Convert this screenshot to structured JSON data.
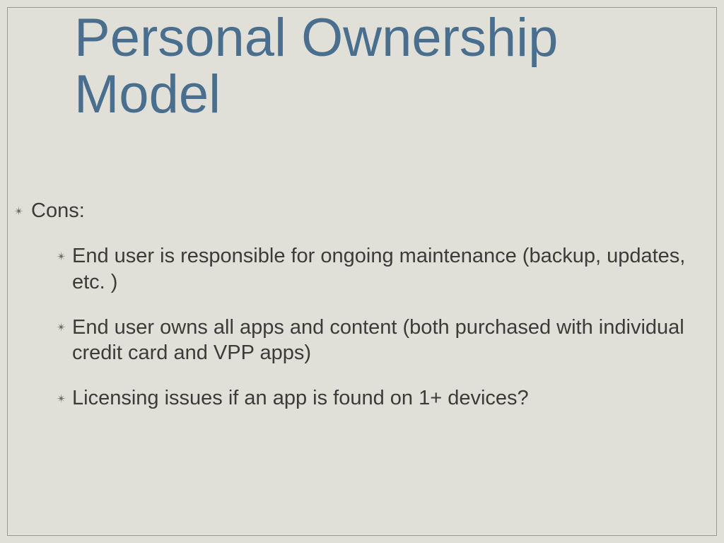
{
  "slide": {
    "title": "Personal Ownership Model",
    "section_label": "Cons:",
    "bullets": [
      "End user is responsible for ongoing maintenance (backup, updates, etc. )",
      "End user owns all apps and content (both purchased with individual credit card and VPP apps)",
      "Licensing issues if an app is found on 1+ devices?"
    ],
    "colors": {
      "background": "#e1e0d8",
      "title": "#4a6f8e",
      "text": "#3b3b39",
      "bullet": "#6b6b63",
      "frame": "#9a998f"
    }
  }
}
